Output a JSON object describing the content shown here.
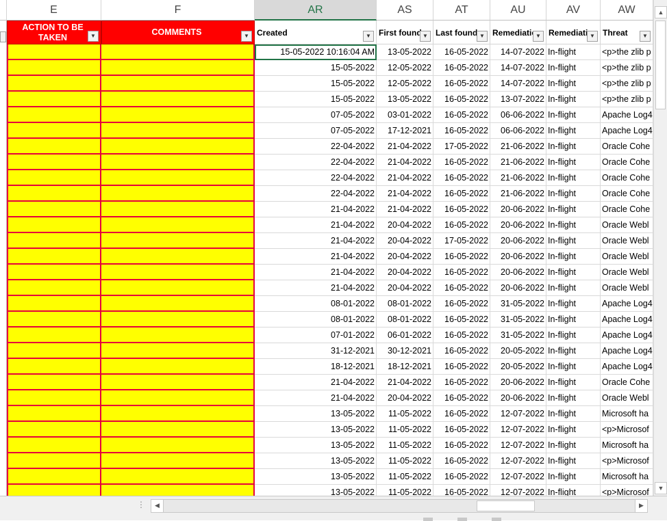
{
  "columns": [
    {
      "letter": "E"
    },
    {
      "letter": "F"
    },
    {
      "letter": "AR"
    },
    {
      "letter": "AS"
    },
    {
      "letter": "AT"
    },
    {
      "letter": "AU"
    },
    {
      "letter": "AV"
    },
    {
      "letter": "AW"
    }
  ],
  "selected_column": "AR",
  "headers": {
    "action": "ACTION TO BE TAKEN",
    "comments": "COMMENTS",
    "created": "Created",
    "first_found": "First found",
    "last_found": "Last found",
    "remediation_due": "Remediatio",
    "remediation_status": "Remediati",
    "threat": "Threat"
  },
  "filter_icon": "dropdown-arrow-icon",
  "colors": {
    "header_red": "#ff0000",
    "action_fill": "#ffff00",
    "border_red": "#e6003c",
    "accent": "#217346"
  },
  "rows": [
    {
      "created": "15-05-2022  10:16:04 AM",
      "first": "13-05-2022",
      "last": "16-05-2022",
      "due": "14-07-2022",
      "status": "In-flight",
      "threat": "<p>the zlib p"
    },
    {
      "created": "15-05-2022",
      "first": "12-05-2022",
      "last": "16-05-2022",
      "due": "14-07-2022",
      "status": "In-flight",
      "threat": "<p>the zlib p"
    },
    {
      "created": "15-05-2022",
      "first": "12-05-2022",
      "last": "16-05-2022",
      "due": "14-07-2022",
      "status": "In-flight",
      "threat": "<p>the zlib p"
    },
    {
      "created": "15-05-2022",
      "first": "13-05-2022",
      "last": "16-05-2022",
      "due": "13-07-2022",
      "status": "In-flight",
      "threat": "<p>the zlib p"
    },
    {
      "created": "07-05-2022",
      "first": "03-01-2022",
      "last": "16-05-2022",
      "due": "06-06-2022",
      "status": "In-flight",
      "threat": "Apache Log4"
    },
    {
      "created": "07-05-2022",
      "first": "17-12-2021",
      "last": "16-05-2022",
      "due": "06-06-2022",
      "status": "In-flight",
      "threat": "Apache Log4"
    },
    {
      "created": "22-04-2022",
      "first": "21-04-2022",
      "last": "17-05-2022",
      "due": "21-06-2022",
      "status": "In-flight",
      "threat": "Oracle Cohe"
    },
    {
      "created": "22-04-2022",
      "first": "21-04-2022",
      "last": "16-05-2022",
      "due": "21-06-2022",
      "status": "In-flight",
      "threat": "Oracle Cohe"
    },
    {
      "created": "22-04-2022",
      "first": "21-04-2022",
      "last": "16-05-2022",
      "due": "21-06-2022",
      "status": "In-flight",
      "threat": "Oracle Cohe"
    },
    {
      "created": "22-04-2022",
      "first": "21-04-2022",
      "last": "16-05-2022",
      "due": "21-06-2022",
      "status": "In-flight",
      "threat": "Oracle Cohe"
    },
    {
      "created": "21-04-2022",
      "first": "21-04-2022",
      "last": "16-05-2022",
      "due": "20-06-2022",
      "status": "In-flight",
      "threat": "Oracle Cohe"
    },
    {
      "created": "21-04-2022",
      "first": "20-04-2022",
      "last": "16-05-2022",
      "due": "20-06-2022",
      "status": "In-flight",
      "threat": "Oracle Webl"
    },
    {
      "created": "21-04-2022",
      "first": "20-04-2022",
      "last": "17-05-2022",
      "due": "20-06-2022",
      "status": "In-flight",
      "threat": "Oracle Webl"
    },
    {
      "created": "21-04-2022",
      "first": "20-04-2022",
      "last": "16-05-2022",
      "due": "20-06-2022",
      "status": "In-flight",
      "threat": "Oracle Webl"
    },
    {
      "created": "21-04-2022",
      "first": "20-04-2022",
      "last": "16-05-2022",
      "due": "20-06-2022",
      "status": "In-flight",
      "threat": "Oracle Webl"
    },
    {
      "created": "21-04-2022",
      "first": "20-04-2022",
      "last": "16-05-2022",
      "due": "20-06-2022",
      "status": "In-flight",
      "threat": "Oracle Webl"
    },
    {
      "created": "08-01-2022",
      "first": "08-01-2022",
      "last": "16-05-2022",
      "due": "31-05-2022",
      "status": "In-flight",
      "threat": "Apache Log4"
    },
    {
      "created": "08-01-2022",
      "first": "08-01-2022",
      "last": "16-05-2022",
      "due": "31-05-2022",
      "status": "In-flight",
      "threat": "Apache Log4"
    },
    {
      "created": "07-01-2022",
      "first": "06-01-2022",
      "last": "16-05-2022",
      "due": "31-05-2022",
      "status": "In-flight",
      "threat": "Apache Log4"
    },
    {
      "created": "31-12-2021",
      "first": "30-12-2021",
      "last": "16-05-2022",
      "due": "20-05-2022",
      "status": "In-flight",
      "threat": "Apache Log4"
    },
    {
      "created": "18-12-2021",
      "first": "18-12-2021",
      "last": "16-05-2022",
      "due": "20-05-2022",
      "status": "In-flight",
      "threat": "Apache Log4"
    },
    {
      "created": "21-04-2022",
      "first": "21-04-2022",
      "last": "16-05-2022",
      "due": "20-06-2022",
      "status": "In-flight",
      "threat": "Oracle Cohe"
    },
    {
      "created": "21-04-2022",
      "first": "20-04-2022",
      "last": "16-05-2022",
      "due": "20-06-2022",
      "status": "In-flight",
      "threat": "Oracle Webl"
    },
    {
      "created": "13-05-2022",
      "first": "11-05-2022",
      "last": "16-05-2022",
      "due": "12-07-2022",
      "status": "In-flight",
      "threat": "Microsoft ha"
    },
    {
      "created": "13-05-2022",
      "first": "11-05-2022",
      "last": "16-05-2022",
      "due": "12-07-2022",
      "status": "In-flight",
      "threat": "<p>Microsof"
    },
    {
      "created": "13-05-2022",
      "first": "11-05-2022",
      "last": "16-05-2022",
      "due": "12-07-2022",
      "status": "In-flight",
      "threat": "Microsoft ha"
    },
    {
      "created": "13-05-2022",
      "first": "11-05-2022",
      "last": "16-05-2022",
      "due": "12-07-2022",
      "status": "In-flight",
      "threat": "<p>Microsof"
    },
    {
      "created": "13-05-2022",
      "first": "11-05-2022",
      "last": "16-05-2022",
      "due": "12-07-2022",
      "status": "In-flight",
      "threat": "Microsoft ha"
    },
    {
      "created": "13-05-2022",
      "first": "11-05-2022",
      "last": "16-05-2022",
      "due": "12-07-2022",
      "status": "In-flight",
      "threat": "<p>Microsof"
    }
  ]
}
